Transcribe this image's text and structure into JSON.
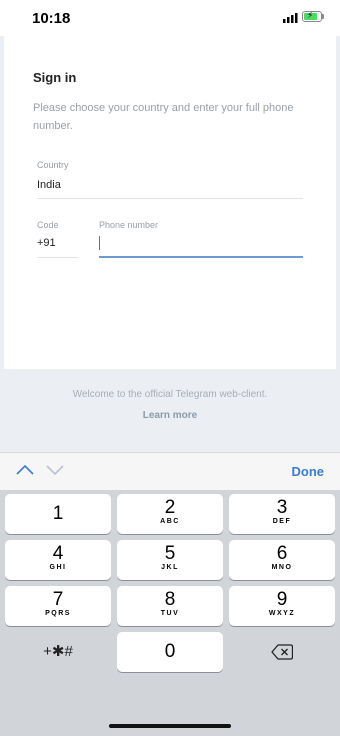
{
  "status_bar": {
    "time": "10:18",
    "signal_icon": "signal-bars-icon",
    "battery_icon": "battery-charging-icon"
  },
  "signin": {
    "title": "Sign in",
    "description": "Please choose your country and enter your full phone number.",
    "country_label": "Country",
    "country_value": "India",
    "code_label": "Code",
    "code_value": "+91",
    "phone_label": "Phone number",
    "phone_value": ""
  },
  "footer": {
    "welcome": "Welcome to the official Telegram web-client.",
    "learn_more": "Learn more"
  },
  "toolbar": {
    "done_label": "Done",
    "up_icon": "chevron-up-icon",
    "down_icon": "chevron-down-icon"
  },
  "keyboard": {
    "keys": [
      {
        "digit": "1",
        "letters": ""
      },
      {
        "digit": "2",
        "letters": "ABC"
      },
      {
        "digit": "3",
        "letters": "DEF"
      },
      {
        "digit": "4",
        "letters": "GHI"
      },
      {
        "digit": "5",
        "letters": "JKL"
      },
      {
        "digit": "6",
        "letters": "MNO"
      },
      {
        "digit": "7",
        "letters": "PQRS"
      },
      {
        "digit": "8",
        "letters": "TUV"
      },
      {
        "digit": "9",
        "letters": "WXYZ"
      }
    ],
    "symbols_label": "+✱#",
    "zero": "0",
    "delete_icon": "backspace-icon"
  },
  "colors": {
    "accent": "#3a7bd5",
    "muted_text": "#9aa0a6",
    "keyboard_bg": "#d1d4d9",
    "battery": "#4cd964"
  }
}
